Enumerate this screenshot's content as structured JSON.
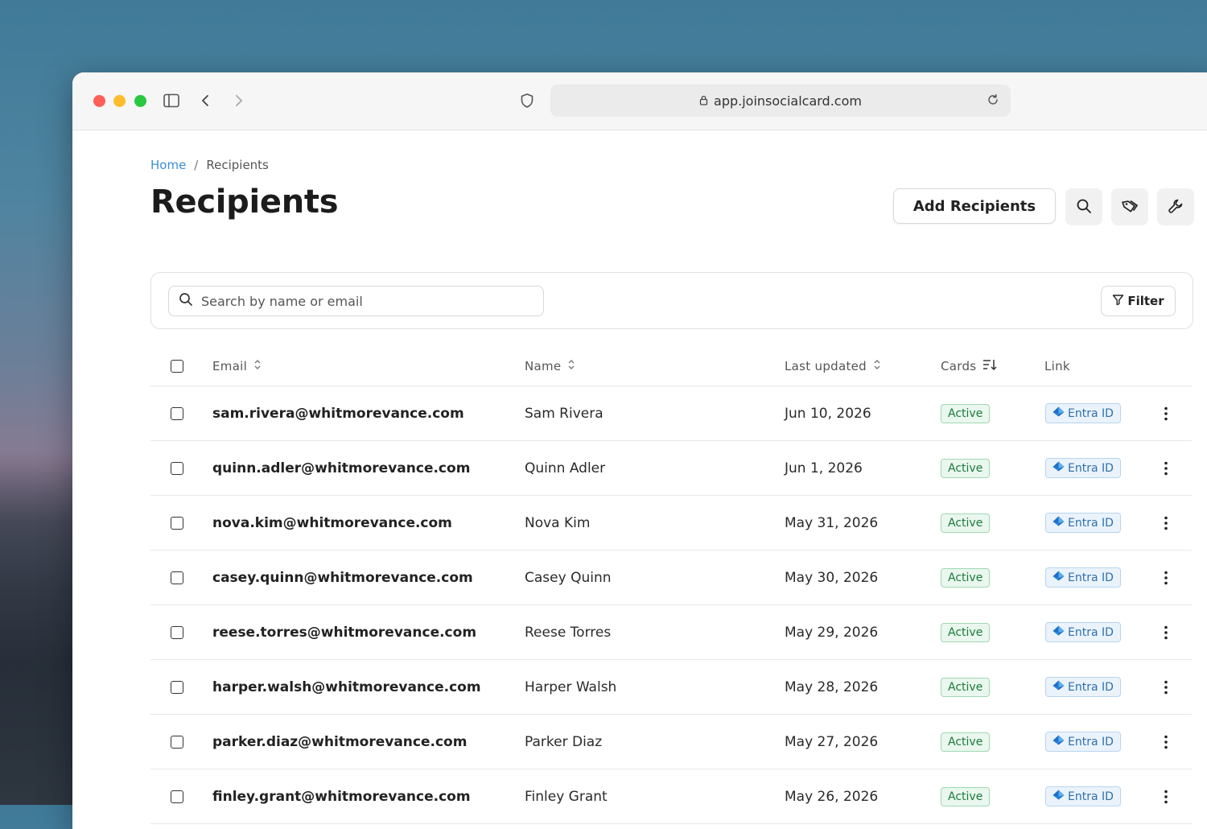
{
  "browser": {
    "url": "app.joinsocialcard.com"
  },
  "breadcrumb": {
    "home": "Home",
    "separator": "/",
    "current": "Recipients"
  },
  "page": {
    "title": "Recipients",
    "add_button": "Add Recipients"
  },
  "search": {
    "placeholder": "Search by name or email",
    "filter_label": "Filter"
  },
  "table": {
    "columns": {
      "email": "Email",
      "name": "Name",
      "last_updated": "Last updated",
      "cards": "Cards",
      "link": "Link"
    },
    "rows": [
      {
        "email": "sam.rivera@whitmorevance.com",
        "name": "Sam Rivera",
        "date": "Jun 10, 2026",
        "status": "Active",
        "link": "Entra ID"
      },
      {
        "email": "quinn.adler@whitmorevance.com",
        "name": "Quinn Adler",
        "date": "Jun 1, 2026",
        "status": "Active",
        "link": "Entra ID"
      },
      {
        "email": "nova.kim@whitmorevance.com",
        "name": "Nova Kim",
        "date": "May 31, 2026",
        "status": "Active",
        "link": "Entra ID"
      },
      {
        "email": "casey.quinn@whitmorevance.com",
        "name": "Casey Quinn",
        "date": "May 30, 2026",
        "status": "Active",
        "link": "Entra ID"
      },
      {
        "email": "reese.torres@whitmorevance.com",
        "name": "Reese Torres",
        "date": "May 29, 2026",
        "status": "Active",
        "link": "Entra ID"
      },
      {
        "email": "harper.walsh@whitmorevance.com",
        "name": "Harper Walsh",
        "date": "May 28, 2026",
        "status": "Active",
        "link": "Entra ID"
      },
      {
        "email": "parker.diaz@whitmorevance.com",
        "name": "Parker Diaz",
        "date": "May 27, 2026",
        "status": "Active",
        "link": "Entra ID"
      },
      {
        "email": "finley.grant@whitmorevance.com",
        "name": "Finley Grant",
        "date": "May 26, 2026",
        "status": "Active",
        "link": "Entra ID"
      }
    ]
  },
  "colors": {
    "accent": "#3b8fd6",
    "active_badge": "#1c7a3a",
    "link_pill": "#2f6fae"
  },
  "icons": {
    "toolbar": [
      "search-icon",
      "tag-icon",
      "wrench-icon"
    ],
    "row_menu": "kebab-icon"
  }
}
